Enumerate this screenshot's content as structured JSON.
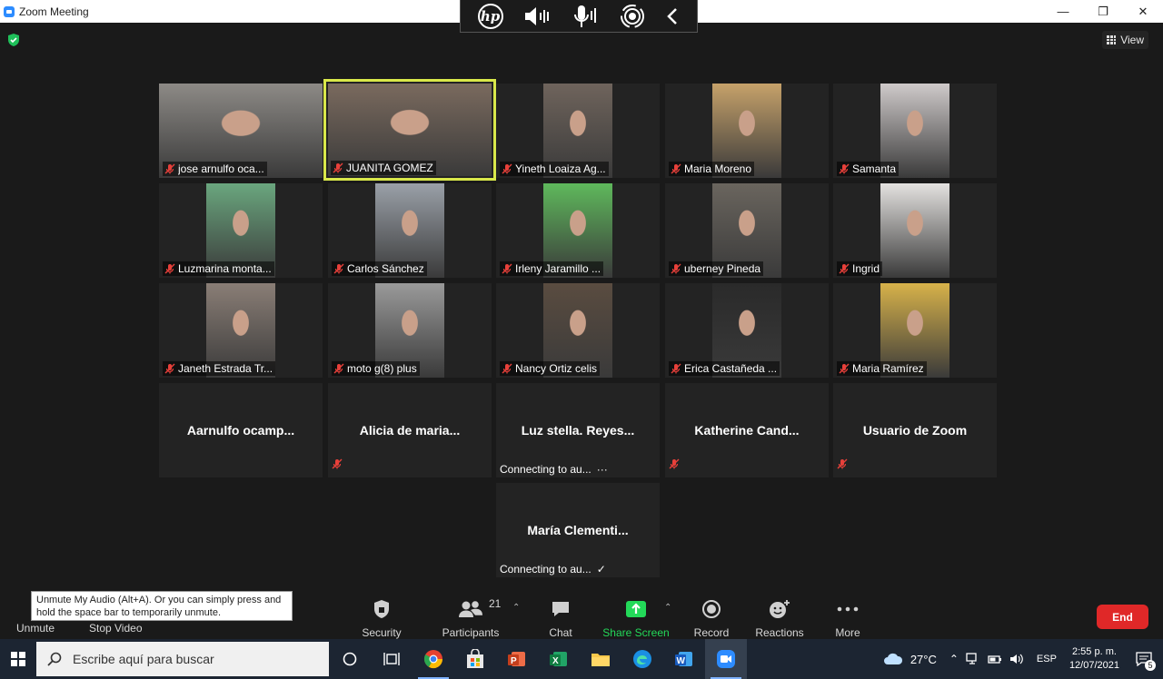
{
  "window": {
    "title": "Zoom Meeting"
  },
  "header": {
    "view_label": "View"
  },
  "participants": [
    {
      "name": "jose arnulfo oca...",
      "muted": true,
      "video_color": "#8d8a86"
    },
    {
      "name": "JUANITA GOMEZ",
      "muted": true,
      "active": true,
      "video_color": "#7a6a5e"
    },
    {
      "name": "Yineth Loaiza Ag...",
      "muted": true,
      "video_color": "#6f645c"
    },
    {
      "name": "Maria Moreno",
      "muted": true,
      "video_color": "#c6a26a"
    },
    {
      "name": "Samanta",
      "muted": true,
      "video_color": "#cfcaca"
    },
    {
      "name": "Luzmarina monta...",
      "muted": true,
      "video_color": "#6aa67e"
    },
    {
      "name": "Carlos Sánchez",
      "muted": true,
      "video_color": "#9aa0a8"
    },
    {
      "name": "Irleny Jaramillo ...",
      "muted": true,
      "video_color": "#5fb95c"
    },
    {
      "name": "uberney Pineda",
      "muted": true,
      "video_color": "#6a655e"
    },
    {
      "name": "Ingrid",
      "muted": true,
      "video_color": "#e4e2e0"
    },
    {
      "name": "Janeth Estrada Tr...",
      "muted": true,
      "video_color": "#8a7e76"
    },
    {
      "name": "moto g(8) plus",
      "muted": true,
      "video_color": "#9a9a9a"
    },
    {
      "name": "Nancy Ortiz celis",
      "muted": true,
      "video_color": "#5a4c40"
    },
    {
      "name": "Erica Castañeda ...",
      "muted": true,
      "video_color": "#2a2a2a"
    },
    {
      "name": "Maria Ramírez",
      "muted": true,
      "video_color": "#d7b24a"
    }
  ],
  "audio_only": [
    {
      "name": "Aarnulfo  ocamp...",
      "muted": false,
      "status": ""
    },
    {
      "name": "Alicia de maria...",
      "muted": true,
      "status": ""
    },
    {
      "name": "Luz stella. Reyes...",
      "muted": false,
      "status": "Connecting to au...",
      "status_icon": "ellipsis-icon",
      "status_glyph": "···"
    },
    {
      "name": "Katherine  Cand...",
      "muted": true,
      "status": ""
    },
    {
      "name": "Usuario de Zoom",
      "muted": true,
      "status": ""
    },
    {
      "name": "María  Clementi...",
      "muted": false,
      "status": "Connecting to au...",
      "status_icon": "checkmark-icon",
      "status_glyph": "✓"
    }
  ],
  "toolbar": {
    "unmute_label": "Unmute",
    "stop_video_label": "Stop Video",
    "tooltip": "Unmute My Audio (Alt+A). Or you can simply press and hold the space bar to temporarily unmute.",
    "security_label": "Security",
    "participants_label": "Participants",
    "participants_count": "21",
    "chat_label": "Chat",
    "share_label": "Share Screen",
    "record_label": "Record",
    "reactions_label": "Reactions",
    "more_label": "More",
    "end_label": "End"
  },
  "taskbar": {
    "search_placeholder": "Escribe aquí para buscar",
    "temperature": "27°C",
    "language": "ESP",
    "time": "2:55 p. m.",
    "date": "12/07/2021",
    "notifications": "5"
  },
  "colors": {
    "share_green": "#23d959",
    "end_red": "#e02828",
    "active_speaker": "#d9e84a",
    "taskbar": "#1c2532"
  }
}
